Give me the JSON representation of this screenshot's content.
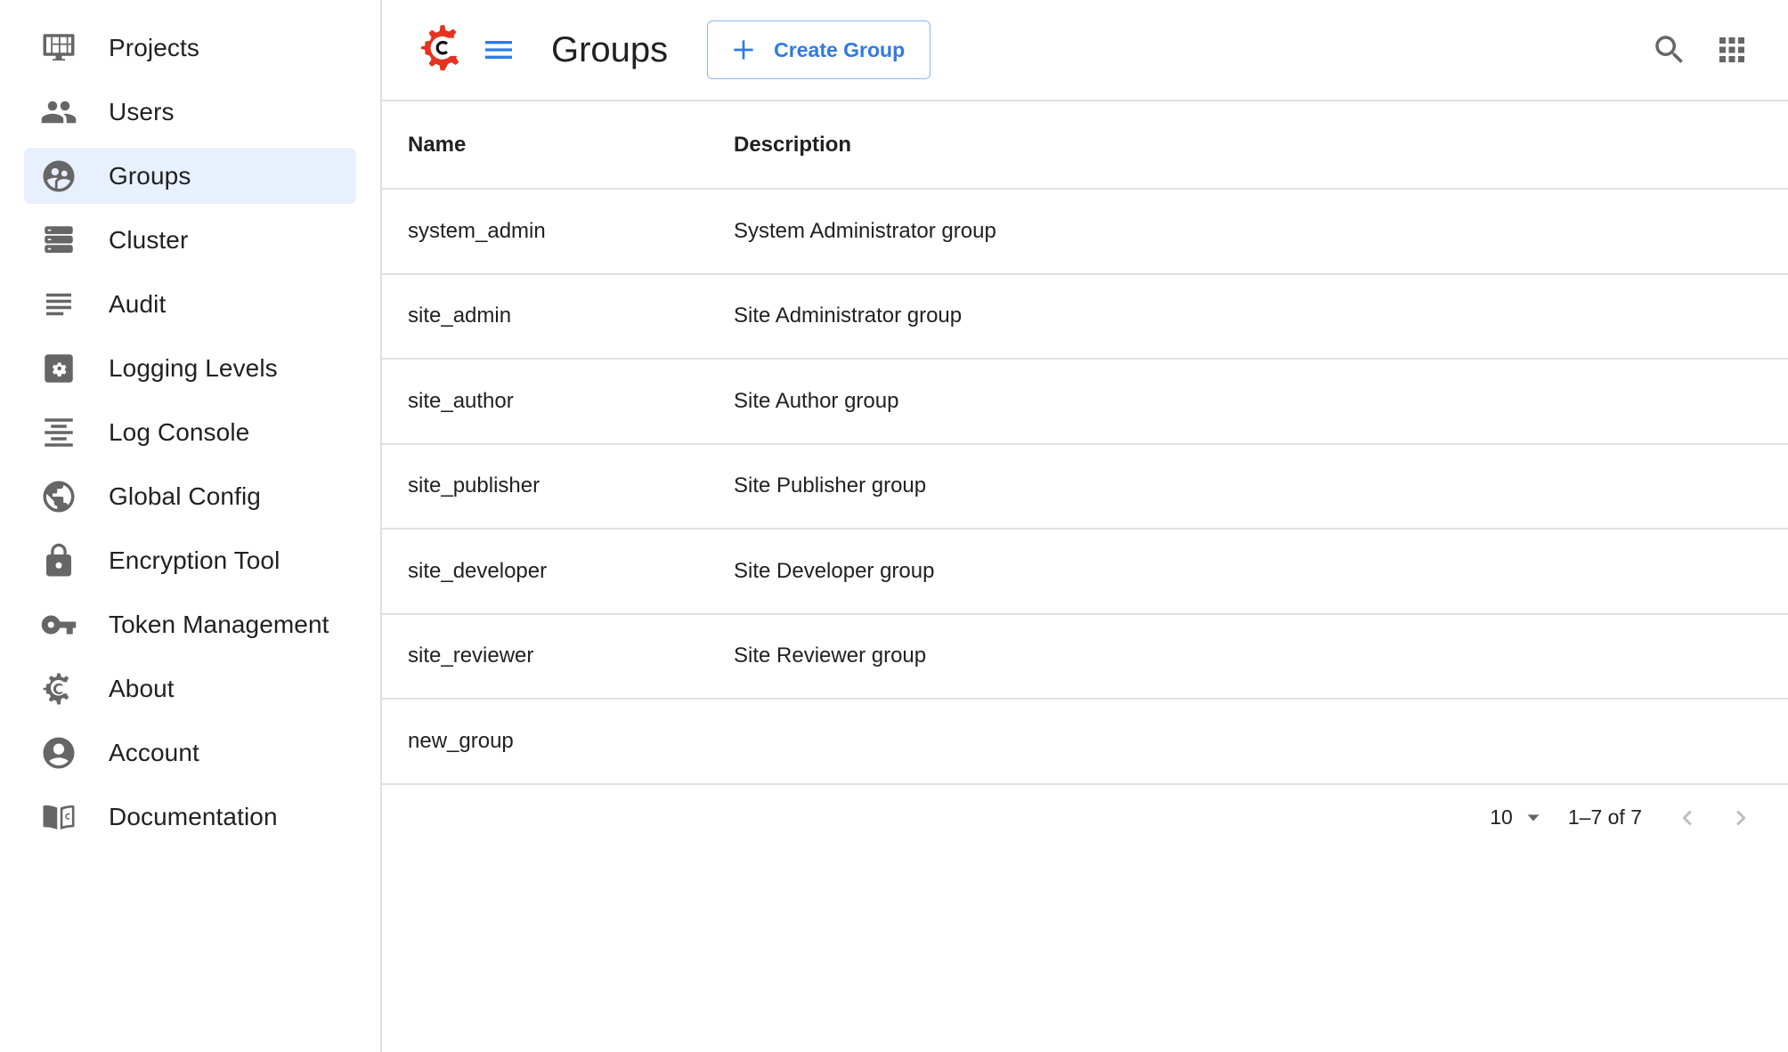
{
  "sidebar": {
    "items": [
      {
        "label": "Projects",
        "icon": "projects-icon",
        "active": false
      },
      {
        "label": "Users",
        "icon": "users-icon",
        "active": false
      },
      {
        "label": "Groups",
        "icon": "groups-icon",
        "active": true
      },
      {
        "label": "Cluster",
        "icon": "cluster-icon",
        "active": false
      },
      {
        "label": "Audit",
        "icon": "audit-icon",
        "active": false
      },
      {
        "label": "Logging Levels",
        "icon": "logging-levels-icon",
        "active": false
      },
      {
        "label": "Log Console",
        "icon": "log-console-icon",
        "active": false
      },
      {
        "label": "Global Config",
        "icon": "globe-icon",
        "active": false
      },
      {
        "label": "Encryption Tool",
        "icon": "lock-icon",
        "active": false
      },
      {
        "label": "Token Management",
        "icon": "key-icon",
        "active": false
      },
      {
        "label": "About",
        "icon": "crafter-gear-icon",
        "active": false
      },
      {
        "label": "Account",
        "icon": "account-circle-icon",
        "active": false
      },
      {
        "label": "Documentation",
        "icon": "book-icon",
        "active": false
      }
    ]
  },
  "header": {
    "logo": "crafter-logo-icon",
    "menu_icon": "hamburger-menu-icon",
    "title": "Groups",
    "create_button_label": "Create Group",
    "search_icon": "search-icon",
    "apps_icon": "apps-grid-icon"
  },
  "colors": {
    "accent": "#2f7ae5",
    "active_nav_bg": "#e8f0fd",
    "logo_red": "#e53221",
    "icon_gray": "#666666",
    "divider": "#e0e0e0"
  },
  "table": {
    "columns": [
      "Name",
      "Description"
    ],
    "rows": [
      {
        "name": "system_admin",
        "description": "System Administrator group"
      },
      {
        "name": "site_admin",
        "description": "Site Administrator group"
      },
      {
        "name": "site_author",
        "description": "Site Author group"
      },
      {
        "name": "site_publisher",
        "description": "Site Publisher group"
      },
      {
        "name": "site_developer",
        "description": "Site Developer group"
      },
      {
        "name": "site_reviewer",
        "description": "Site Reviewer group"
      },
      {
        "name": "new_group",
        "description": ""
      }
    ]
  },
  "pagination": {
    "rows_per_page": "10",
    "range_label": "1–7 of 7",
    "prev_enabled": false,
    "next_enabled": false
  }
}
